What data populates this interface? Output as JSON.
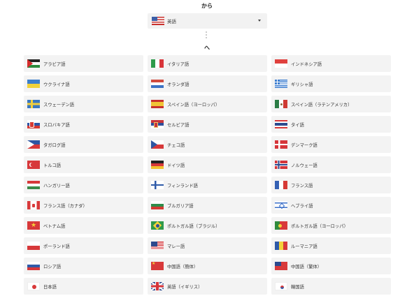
{
  "from_label": "から",
  "to_label": "へ",
  "source": {
    "label": "英語",
    "flag": "us"
  },
  "languages": [
    {
      "label": "アラビア語",
      "flag": "ps"
    },
    {
      "label": "イタリア語",
      "flag": "it"
    },
    {
      "label": "インドネシア語",
      "flag": "id"
    },
    {
      "label": "ウクライナ語",
      "flag": "ua"
    },
    {
      "label": "オランダ語",
      "flag": "nl"
    },
    {
      "label": "ギリシャ語",
      "flag": "gr"
    },
    {
      "label": "スウェーデン語",
      "flag": "se"
    },
    {
      "label": "スペイン語（ヨーロッパ）",
      "flag": "es"
    },
    {
      "label": "スペイン語（ラテンアメリカ）",
      "flag": "mx"
    },
    {
      "label": "スロバキア語",
      "flag": "sk"
    },
    {
      "label": "セルビア語",
      "flag": "rs"
    },
    {
      "label": "タイ語",
      "flag": "th"
    },
    {
      "label": "タガログ語",
      "flag": "ph"
    },
    {
      "label": "チェコ語",
      "flag": "cz"
    },
    {
      "label": "デンマーク語",
      "flag": "dk"
    },
    {
      "label": "トルコ語",
      "flag": "tr"
    },
    {
      "label": "ドイツ語",
      "flag": "de"
    },
    {
      "label": "ノルウェー語",
      "flag": "no"
    },
    {
      "label": "ハンガリー語",
      "flag": "hu"
    },
    {
      "label": "フィンランド語",
      "flag": "fi"
    },
    {
      "label": "フランス語",
      "flag": "fr"
    },
    {
      "label": "フランス語（カナダ）",
      "flag": "ca"
    },
    {
      "label": "ブルガリア語",
      "flag": "bg"
    },
    {
      "label": "ヘブライ語",
      "flag": "il"
    },
    {
      "label": "ベトナム語",
      "flag": "vn"
    },
    {
      "label": "ポルトガル語（ブラジル）",
      "flag": "br"
    },
    {
      "label": "ポルトガル語（ヨーロッパ）",
      "flag": "pt"
    },
    {
      "label": "ポーランド語",
      "flag": "pl"
    },
    {
      "label": "マレー語",
      "flag": "my"
    },
    {
      "label": "ルーマニア語",
      "flag": "ro"
    },
    {
      "label": "ロシア語",
      "flag": "ru"
    },
    {
      "label": "中国語（簡体）",
      "flag": "cn"
    },
    {
      "label": "中国語（繁体）",
      "flag": "tw"
    },
    {
      "label": "日本語",
      "flag": "jp"
    },
    {
      "label": "英語（イギリス）",
      "flag": "gb"
    },
    {
      "label": "韓国語",
      "flag": "kr"
    }
  ]
}
